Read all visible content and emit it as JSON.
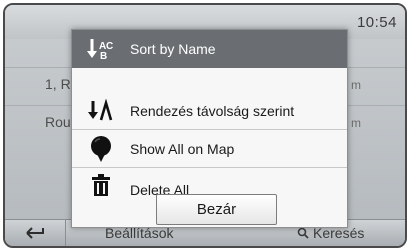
{
  "status": {
    "clock": "10:54"
  },
  "background_list": [
    {
      "left": "1, R",
      "right": "m"
    },
    {
      "left": "Rou",
      "right": "m"
    }
  ],
  "menu": {
    "items": [
      {
        "label": "Sort by Name",
        "icon": "sort-alpha-icon",
        "selected": true
      },
      {
        "label": "Rendezés távolság szerint",
        "icon": "sort-distance-icon",
        "selected": false
      },
      {
        "label": "Show All on Map",
        "icon": "map-pin-icon",
        "selected": false
      },
      {
        "label": "Delete All",
        "icon": "trash-icon",
        "selected": false
      }
    ],
    "close_label": "Bezár"
  },
  "bottom_bar": {
    "back_icon": "back-arrow-icon",
    "settings_label": "Beállítások",
    "search_label": "Keresés",
    "search_icon": "search-icon"
  },
  "colors": {
    "selected_row": "#6a6e72",
    "popup_bg": "#f7f7f7"
  }
}
